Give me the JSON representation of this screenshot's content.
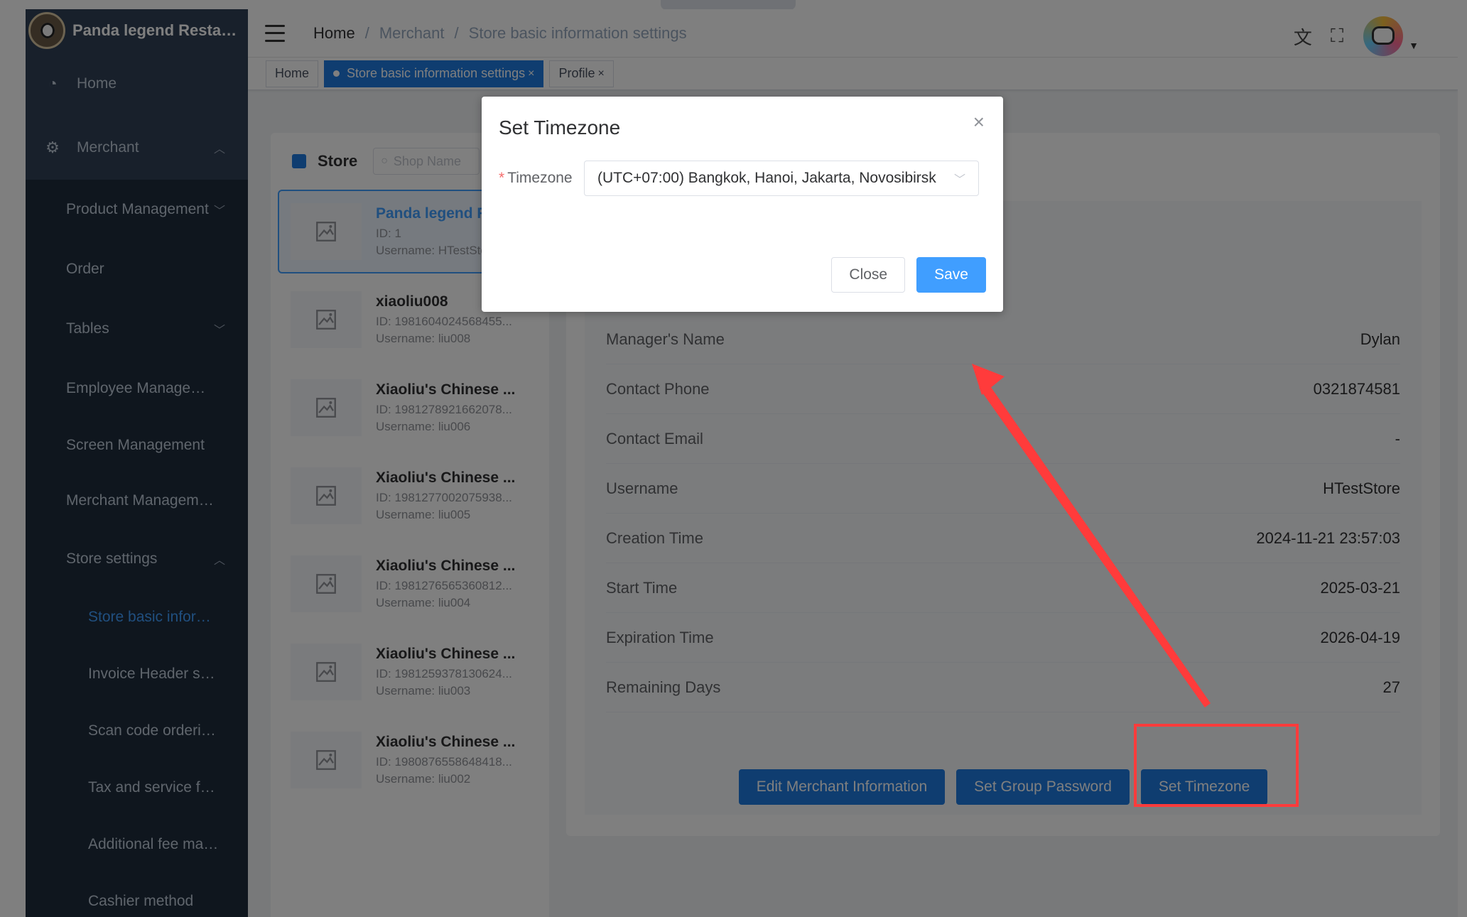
{
  "app": {
    "store_name": "Panda legend Restaurant"
  },
  "sidebar": {
    "home_label": "Home",
    "merchant_label": "Merchant",
    "items": [
      {
        "label": "Product Management",
        "has_chevron": true
      },
      {
        "label": "Order",
        "has_chevron": false
      },
      {
        "label": "Tables",
        "has_chevron": true
      },
      {
        "label": "Employee Management",
        "has_chevron": false
      },
      {
        "label": "Screen Management",
        "has_chevron": false
      },
      {
        "label": "Merchant Management",
        "has_chevron": false
      },
      {
        "label": "Store settings",
        "has_chevron": true
      }
    ],
    "store_settings_children": [
      {
        "label": "Store basic information settings",
        "active": true
      },
      {
        "label": "Invoice Header settings",
        "active": false
      },
      {
        "label": "Scan code ordering settings",
        "active": false
      },
      {
        "label": "Tax and service fee settings",
        "active": false
      },
      {
        "label": "Additional fee management",
        "active": false
      },
      {
        "label": "Cashier method",
        "active": false
      }
    ]
  },
  "navbar": {
    "breadcrumb": [
      "Home",
      "Merchant",
      "Store basic information settings"
    ],
    "icons": [
      "translate-icon",
      "fullscreen-icon",
      "avatar"
    ]
  },
  "tags": [
    {
      "label": "Home",
      "active": false,
      "closable": false
    },
    {
      "label": "Store basic information settings",
      "active": true,
      "closable": true
    },
    {
      "label": "Profile",
      "active": false,
      "closable": true
    }
  ],
  "store_panel": {
    "title": "Store",
    "search_placeholder": "Shop Name",
    "stores": [
      {
        "name": "Panda legend Restaurant",
        "id": "ID: 1",
        "username": "Username: HTestStore",
        "selected": true
      },
      {
        "name": "xiaoliu008",
        "id": "ID: 1981604024568455...",
        "username": "Username: liu008",
        "selected": false
      },
      {
        "name": "Xiaoliu's Chinese ...",
        "id": "ID: 1981278921662078...",
        "username": "Username: liu006",
        "selected": false
      },
      {
        "name": "Xiaoliu's Chinese ...",
        "id": "ID: 1981277002075938...",
        "username": "Username: liu005",
        "selected": false
      },
      {
        "name": "Xiaoliu's Chinese ...",
        "id": "ID: 1981276565360812...",
        "username": "Username: liu004",
        "selected": false
      },
      {
        "name": "Xiaoliu's Chinese ...",
        "id": "ID: 1981259378130624...",
        "username": "Username: liu003",
        "selected": false
      },
      {
        "name": "Xiaoliu's Chinese ...",
        "id": "ID: 1980876558648418...",
        "username": "Username: liu002",
        "selected": false
      }
    ]
  },
  "details": {
    "rows": [
      {
        "key": "Manager's Name",
        "value": "Dylan"
      },
      {
        "key": "Contact Phone",
        "value": "0321874581"
      },
      {
        "key": "Contact Email",
        "value": "-"
      },
      {
        "key": "Username",
        "value": "HTestStore"
      },
      {
        "key": "Creation Time",
        "value": "2024-11-21 23:57:03"
      },
      {
        "key": "Start Time",
        "value": "2025-03-21"
      },
      {
        "key": "Expiration Time",
        "value": "2026-04-19"
      },
      {
        "key": "Remaining Days",
        "value": "27"
      }
    ],
    "actions": {
      "edit": "Edit Merchant Information",
      "group_password": "Set Group Password",
      "timezone": "Set Timezone"
    }
  },
  "dialog": {
    "title": "Set Timezone",
    "timezone_label": "Timezone",
    "timezone_value": "(UTC+07:00) Bangkok, Hanoi, Jakarta, Novosibirsk",
    "close_label": "Close",
    "save_label": "Save"
  },
  "colors": {
    "primary": "#1f7ae0",
    "save": "#409eff",
    "sidebar": "#304156",
    "annotation": "#ff3b3b"
  }
}
